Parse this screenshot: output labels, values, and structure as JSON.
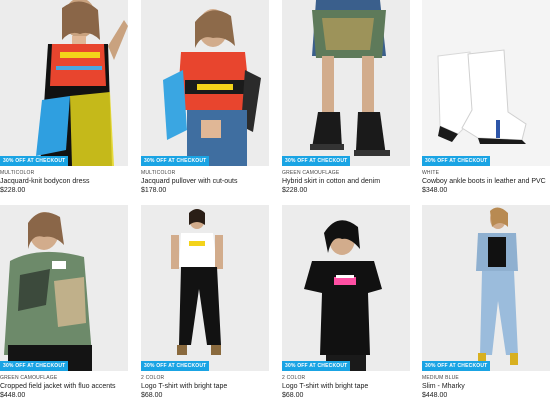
{
  "products": [
    {
      "badge": "30% OFF AT CHECKOUT",
      "color": "MULTICOLOR",
      "name": "Jacquard-knit bodycon dress",
      "price": "$228.00",
      "bg": "#ececec"
    },
    {
      "badge": "30% OFF AT CHECKOUT",
      "color": "MULTICOLOR",
      "name": "Jacquard pullover with cut-outs",
      "price": "$178.00",
      "bg": "#ececec"
    },
    {
      "badge": "30% OFF AT CHECKOUT",
      "color": "GREEN CAMOUFLAGE",
      "name": "Hybrid skirt in cotton and denim",
      "price": "$228.00",
      "bg": "#ececec"
    },
    {
      "badge": "30% OFF AT CHECKOUT",
      "color": "WHITE",
      "name": "Cowboy ankle boots in leather and PVC",
      "price": "$348.00",
      "bg": "#f4f4f4"
    },
    {
      "badge": "30% OFF AT CHECKOUT",
      "color": "GREEN CAMOUFLAGE",
      "name": "Cropped field jacket with fluo accents",
      "price": "$448.00",
      "bg": "#ececec"
    },
    {
      "badge": "30% OFF AT CHECKOUT",
      "color": "2 COLOR",
      "name": "Logo T-shirt with bright tape",
      "price": "$68.00",
      "bg": "#ececec"
    },
    {
      "badge": "30% OFF AT CHECKOUT",
      "color": "2 COLOR",
      "name": "Logo T-shirt with bright tape",
      "price": "$68.00",
      "bg": "#ececec"
    },
    {
      "badge": "30% OFF AT CHECKOUT",
      "color": "MEDIUM BLUE",
      "name": "Slim - Mharky",
      "price": "$448.00",
      "bg": "#ececec"
    }
  ],
  "accent": "#1aa4e4"
}
